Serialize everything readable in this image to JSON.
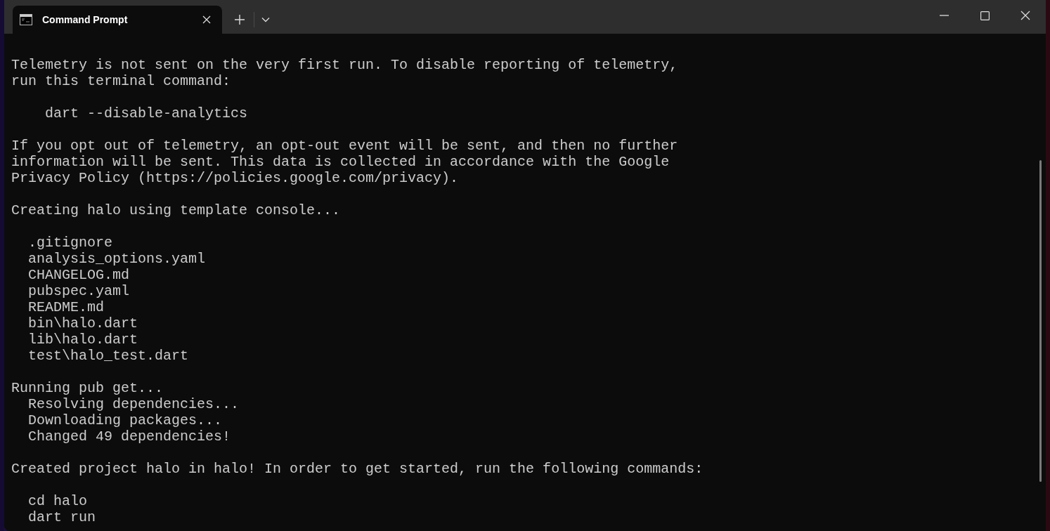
{
  "tabs": [
    {
      "title": "Command Prompt",
      "selected": true
    }
  ],
  "terminal": {
    "blocks": [
      {
        "lines": [
          "Telemetry is not sent on the very first run. To disable reporting of telemetry,",
          "run this terminal command:"
        ]
      },
      {
        "lines": [
          "    dart --disable-analytics"
        ]
      },
      {
        "lines": [
          "If you opt out of telemetry, an opt-out event will be sent, and then no further",
          "information will be sent. This data is collected in accordance with the Google",
          "Privacy Policy (https://policies.google.com/privacy)."
        ]
      },
      {
        "lines": [
          "Creating halo using template console..."
        ]
      },
      {
        "lines": [
          "  .gitignore",
          "  analysis_options.yaml",
          "  CHANGELOG.md",
          "  pubspec.yaml",
          "  README.md",
          "  bin\\halo.dart",
          "  lib\\halo.dart",
          "  test\\halo_test.dart"
        ]
      },
      {
        "lines": [
          "Running pub get...",
          "  Resolving dependencies...",
          "  Downloading packages...",
          "  Changed 49 dependencies!"
        ]
      },
      {
        "lines": [
          "Created project halo in halo! In order to get started, run the following commands:"
        ]
      },
      {
        "lines": [
          "  cd halo",
          "  dart run"
        ]
      }
    ]
  }
}
